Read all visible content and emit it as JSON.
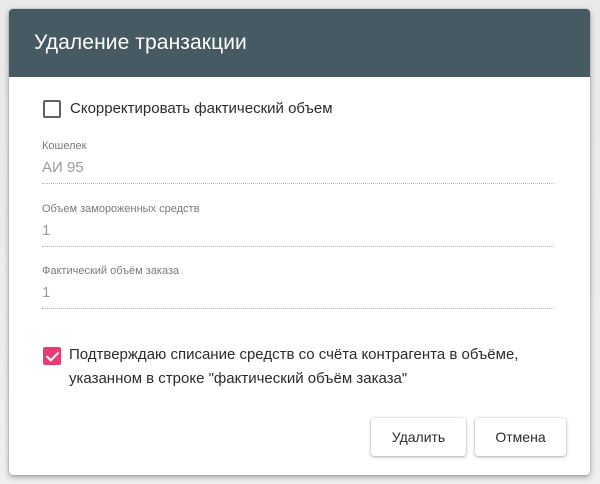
{
  "dialog": {
    "title": "Удаление транзакции",
    "header_color": "#465a64",
    "accent_color": "#e73d74"
  },
  "correct_checkbox": {
    "label": "Скорректировать фактический объем",
    "checked": false
  },
  "fields": [
    {
      "label": "Кошелек",
      "value": "АИ 95"
    },
    {
      "label": "Объем замороженных средств",
      "value": "1"
    },
    {
      "label": "Фактический объём заказа",
      "value": "1"
    }
  ],
  "confirm_checkbox": {
    "label_line1": "Подтверждаю списание средств со счёта контрагента в объёме,",
    "label_line2": "указанном в строке \"фактический объём заказа\"",
    "checked": true
  },
  "buttons": {
    "delete_label": "Удалить",
    "cancel_label": "Отмена"
  }
}
